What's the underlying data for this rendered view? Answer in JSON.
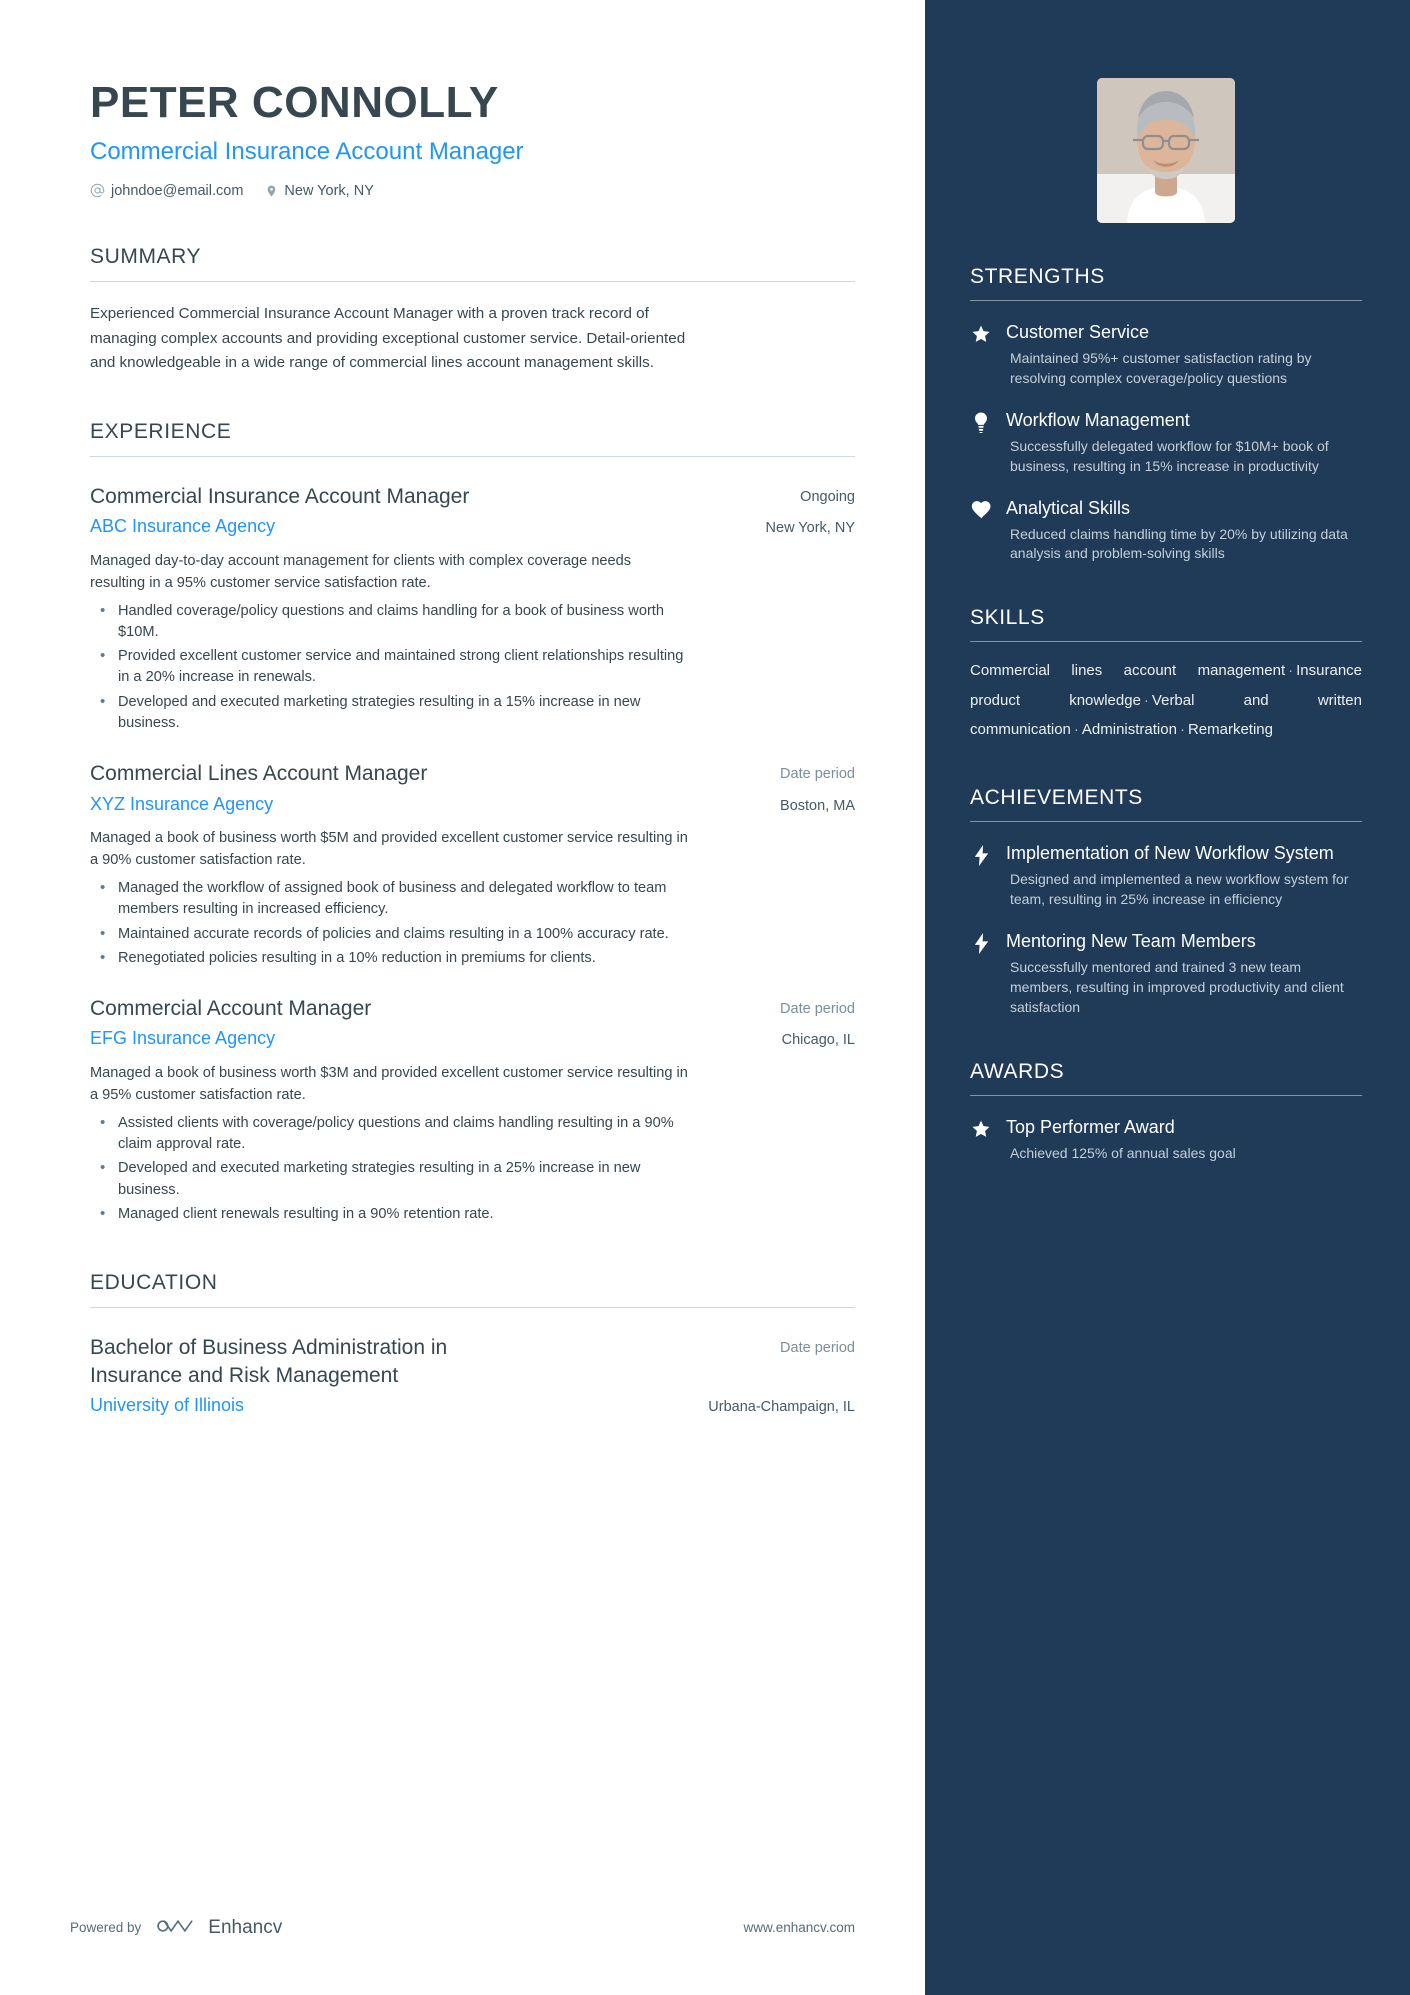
{
  "colors": {
    "accent_blue": "#2196f3",
    "sidebar_bg": "#1f3b57",
    "heading": "#37474f",
    "muted": "#78909c"
  },
  "header": {
    "name": "PETER CONNOLLY",
    "job_title": "Commercial Insurance Account Manager",
    "email": "johndoe@email.com",
    "location": "New York, NY",
    "email_icon": "at-icon",
    "location_icon": "map-pin-icon"
  },
  "summary": {
    "title": "SUMMARY",
    "text": "Experienced Commercial Insurance Account Manager with a proven track record of managing complex accounts and providing exceptional customer service. Detail-oriented and knowledgeable in a wide range of commercial lines account management skills."
  },
  "experience": {
    "title": "EXPERIENCE",
    "entries": [
      {
        "title": "Commercial Insurance Account Manager",
        "date": "Ongoing",
        "date_muted": false,
        "organization": "ABC Insurance Agency",
        "location": "New York, NY",
        "description": "Managed day-to-day account management for clients with complex coverage needs resulting in a 95% customer service satisfaction rate.",
        "bullets": [
          "Handled coverage/policy questions and claims handling for a book of business worth $10M.",
          "Provided excellent customer service and maintained strong client relationships resulting in a 20% increase in renewals.",
          "Developed and executed marketing strategies resulting in a 15% increase in new business."
        ]
      },
      {
        "title": "Commercial Lines Account Manager",
        "date": "Date period",
        "date_muted": true,
        "organization": "XYZ Insurance Agency",
        "location": "Boston, MA",
        "description": "Managed a book of business worth $5M and provided excellent customer service resulting in a 90% customer satisfaction rate.",
        "bullets": [
          "Managed the workflow of assigned book of business and delegated workflow to team members resulting in increased efficiency.",
          "Maintained accurate records of policies and claims resulting in a 100% accuracy rate.",
          "Renegotiated policies resulting in a 10% reduction in premiums for clients."
        ]
      },
      {
        "title": "Commercial Account Manager",
        "date": "Date period",
        "date_muted": true,
        "organization": "EFG Insurance Agency",
        "location": "Chicago, IL",
        "description": "Managed a book of business worth $3M and provided excellent customer service resulting in a 95% customer satisfaction rate.",
        "bullets": [
          "Assisted clients with coverage/policy questions and claims handling resulting in a 90% claim approval rate.",
          "Developed and executed marketing strategies resulting in a 25% increase in new business.",
          "Managed client renewals resulting in a 90% retention rate."
        ]
      }
    ]
  },
  "education": {
    "title": "EDUCATION",
    "entries": [
      {
        "title": "Bachelor of Business Administration in Insurance and Risk Management",
        "date": "Date period",
        "date_muted": true,
        "organization": "University of Illinois",
        "location": "Urbana-Champaign, IL"
      }
    ]
  },
  "footer": {
    "powered_by": "Powered by",
    "brand": "Enhancv",
    "brand_icon": "enhancv-logo-icon",
    "website": "www.enhancv.com"
  },
  "sidebar": {
    "photo_alt": "profile-photo",
    "strengths": {
      "title": "STRENGTHS",
      "items": [
        {
          "icon": "star-icon",
          "name": "Customer Service",
          "description": "Maintained 95%+ customer satisfaction rating by resolving complex coverage/policy questions"
        },
        {
          "icon": "lightbulb-icon",
          "name": "Workflow Management",
          "description": "Successfully delegated workflow for $10M+ book of business, resulting in 15% increase in productivity"
        },
        {
          "icon": "heart-icon",
          "name": "Analytical Skills",
          "description": "Reduced claims handling time by 20% by utilizing data analysis and problem-solving skills"
        }
      ]
    },
    "skills": {
      "title": "SKILLS",
      "separator": "·",
      "items": [
        "Commercial lines account management",
        "Insurance product knowledge",
        "Verbal and written communication",
        "Administration",
        "Remarketing"
      ]
    },
    "achievements": {
      "title": "ACHIEVEMENTS",
      "items": [
        {
          "icon": "bolt-icon",
          "name": "Implementation of New Workflow System",
          "description": "Designed and implemented a new workflow system for team, resulting in 25% increase in efficiency"
        },
        {
          "icon": "bolt-icon",
          "name": "Mentoring New Team Members",
          "description": "Successfully mentored and trained 3 new team members, resulting in improved productivity and client satisfaction"
        }
      ]
    },
    "awards": {
      "title": "AWARDS",
      "items": [
        {
          "icon": "star-icon",
          "name": "Top Performer Award",
          "description": "Achieved 125% of annual sales goal"
        }
      ]
    }
  }
}
